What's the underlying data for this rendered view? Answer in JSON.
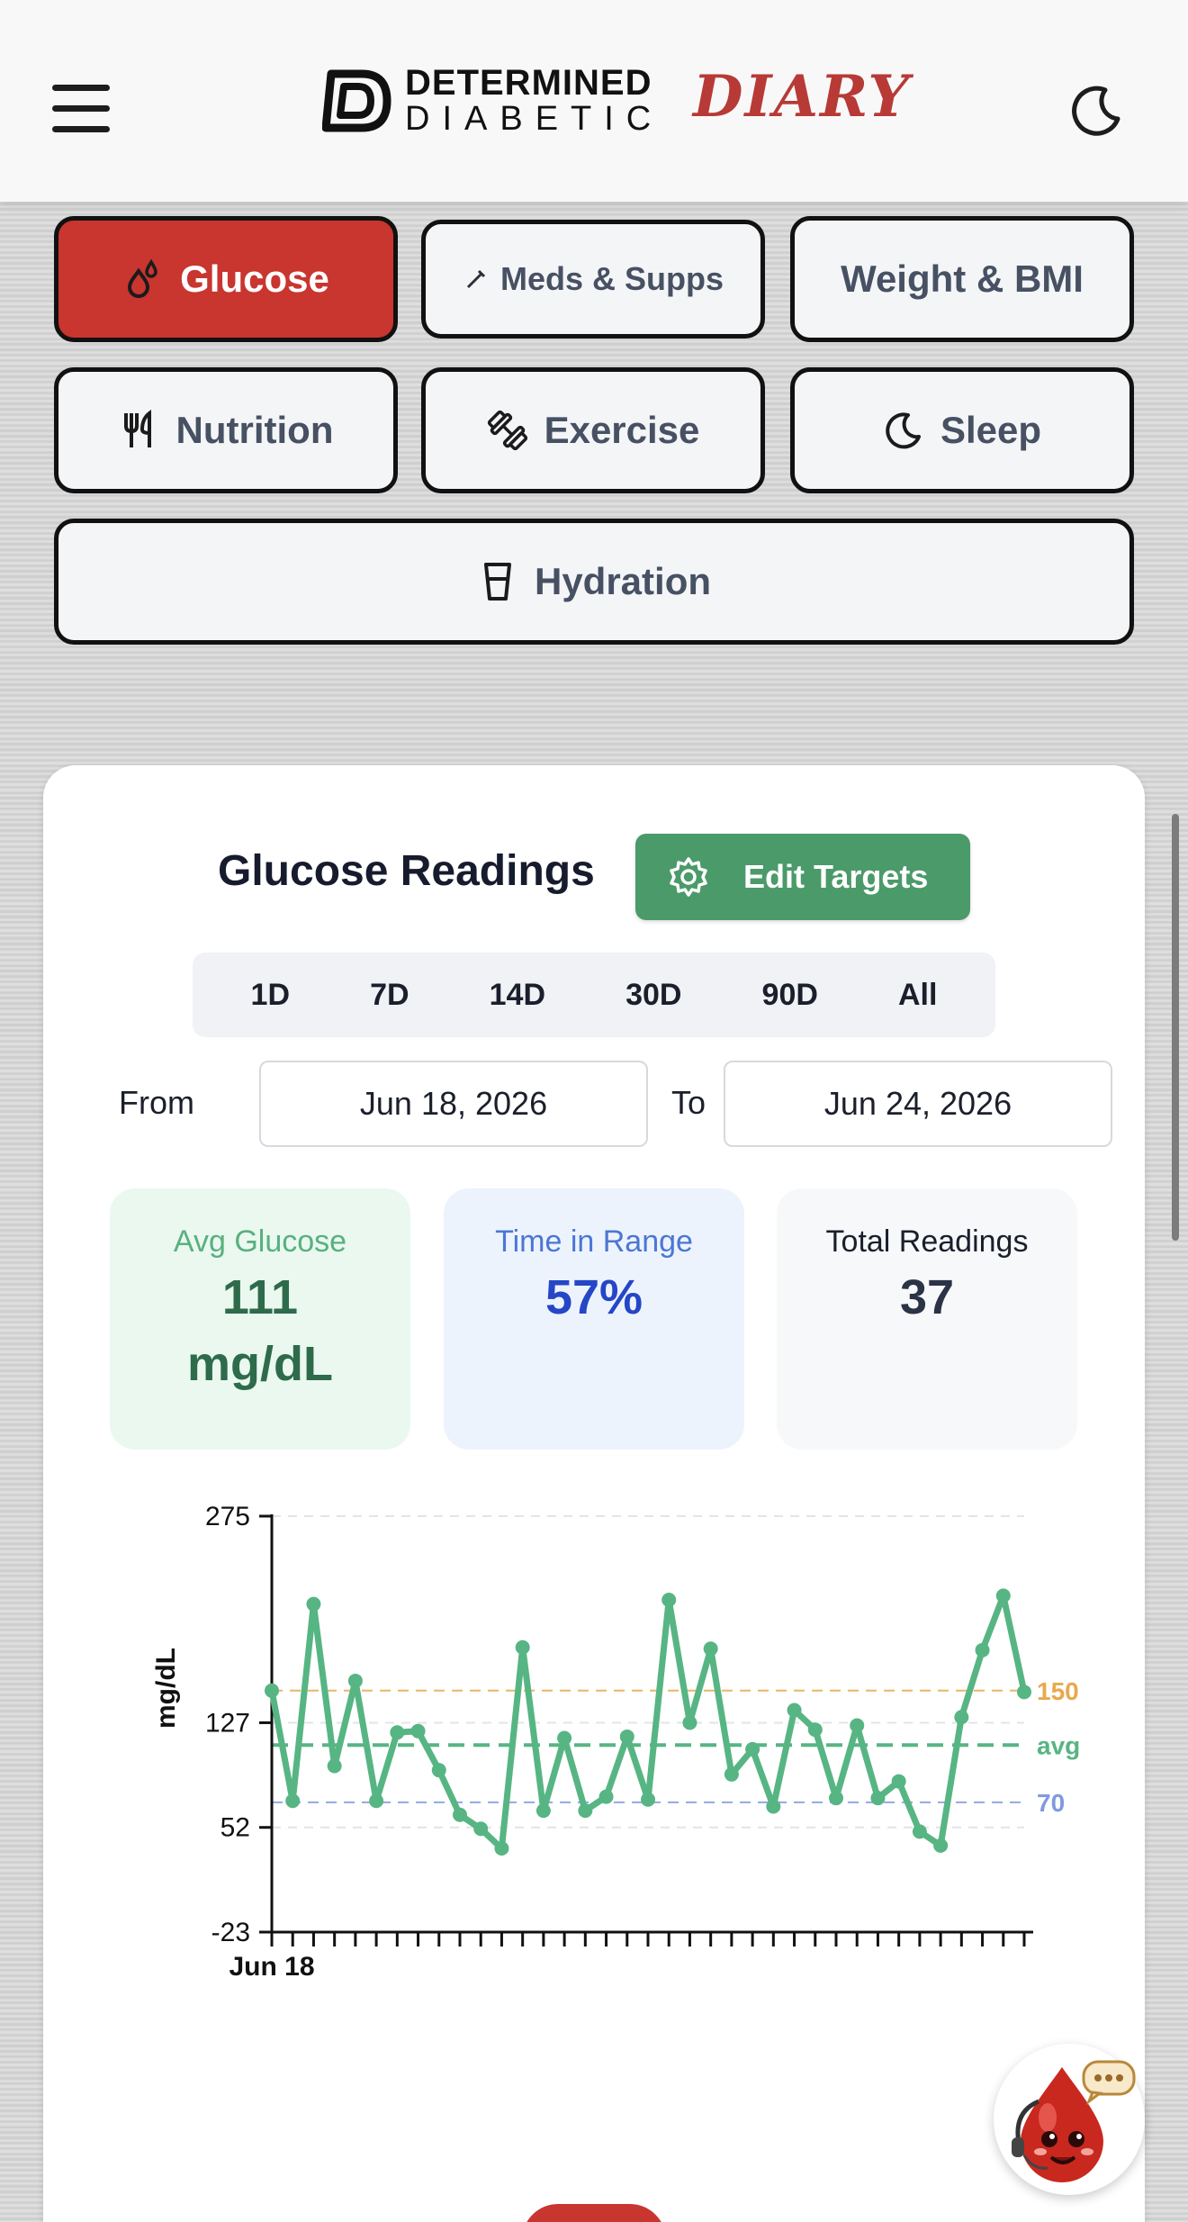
{
  "header": {
    "logo_top": "DETERMINED",
    "logo_bottom": "DIABETIC",
    "logo_diary": "DIARY"
  },
  "tabs": [
    {
      "label": "Glucose",
      "icon": "drops-icon",
      "active": true
    },
    {
      "label": "Meds & Supps",
      "icon": "pill-icon",
      "active": false
    },
    {
      "label": "Weight & BMI",
      "icon": "",
      "active": false
    },
    {
      "label": "Nutrition",
      "icon": "utensils-icon",
      "active": false
    },
    {
      "label": "Exercise",
      "icon": "dumbbell-icon",
      "active": false
    },
    {
      "label": "Sleep",
      "icon": "moon-icon",
      "active": false
    },
    {
      "label": "Hydration",
      "icon": "glass-icon",
      "active": false
    }
  ],
  "card": {
    "title": "Glucose Readings",
    "edit_targets_label": "Edit Targets",
    "ranges": [
      "1D",
      "7D",
      "14D",
      "30D",
      "90D",
      "All"
    ],
    "from_label": "From",
    "from_value": "Jun 18, 2026",
    "to_label": "To",
    "to_value": "Jun 24, 2026"
  },
  "stats": {
    "avg_title": "Avg Glucose",
    "avg_value": "111",
    "avg_unit": "mg/dL",
    "tir_title": "Time in Range",
    "tir_value": "57%",
    "total_title": "Total Readings",
    "total_value": "37"
  },
  "colors": {
    "accent_red": "#c9352f",
    "green": "#4b9a6a",
    "line_green": "#57b583",
    "target_high": "#e8a94d",
    "target_low": "#7f9ae0"
  },
  "chart_data": {
    "type": "line",
    "ylabel": "mg/dL",
    "y_ticks": [
      275,
      127,
      52,
      -23
    ],
    "ylim": [
      -23,
      275
    ],
    "x_tick_label": "Jun 18",
    "reference_lines": [
      {
        "label": "150",
        "value": 150
      },
      {
        "label": "avg",
        "value": 111
      },
      {
        "label": "70",
        "value": 70
      }
    ],
    "grid": "dashed horizontal",
    "series": [
      {
        "values": [
          150,
          71,
          212,
          96,
          157,
          71,
          120,
          121,
          93,
          61,
          51,
          37,
          181,
          64,
          116,
          64,
          74,
          117,
          72,
          215,
          127,
          180,
          90,
          108,
          67,
          136,
          122,
          73,
          125,
          73,
          85,
          49,
          39,
          131,
          179,
          218,
          149
        ]
      }
    ]
  }
}
